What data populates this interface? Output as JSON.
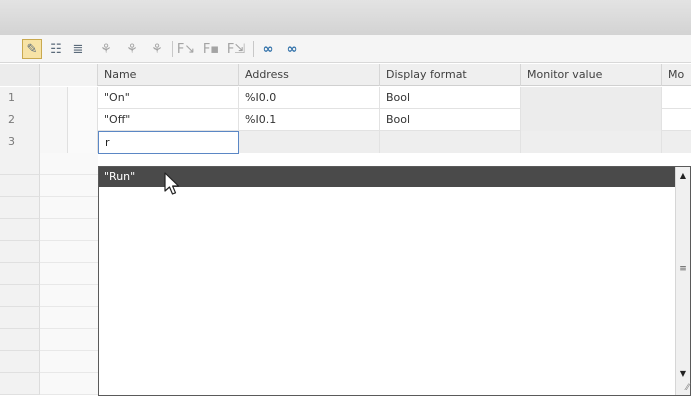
{
  "toolbar": {
    "icons": [
      "edit-active-icon",
      "table-view-icon",
      "force-table-icon",
      "monitor-icon-a",
      "monitor-icon-b",
      "monitor-icon-c",
      "force-f-icon",
      "force-f-set-icon",
      "force-f-all-icon",
      "monitor-all-icon",
      "monitor-once-icon"
    ],
    "glyphs": {
      "edit": "✎",
      "table": "☷",
      "force_table": "≣",
      "mon_a": "⚘",
      "mon_b": "⚘",
      "mon_c": "⚘",
      "f1": "F↘",
      "f2": "F▪",
      "f3": "F⇲",
      "mon_all": "∞",
      "mon_once": "∞"
    }
  },
  "table": {
    "columns": [
      "Name",
      "Address",
      "Display format",
      "Monitor value",
      "Mo"
    ],
    "rows": [
      {
        "num": "1",
        "name": "\"On\"",
        "address": "%I0.0",
        "format": "Bool",
        "monitor": ""
      },
      {
        "num": "2",
        "name": "\"Off\"",
        "address": "%I0.1",
        "format": "Bool",
        "monitor": ""
      },
      {
        "num": "3",
        "name": "r",
        "address": "",
        "format": "",
        "monitor": ""
      }
    ]
  },
  "dropdown": {
    "items": [
      "\"Run\""
    ],
    "scroll_up": "▲",
    "scroll_down": "▼",
    "grip": "≡",
    "resize": "⁄⁄"
  },
  "colors": {
    "selection": "#4a4a4a",
    "edit_border": "#5b87c5",
    "active_tool": "#f7e3a6"
  }
}
